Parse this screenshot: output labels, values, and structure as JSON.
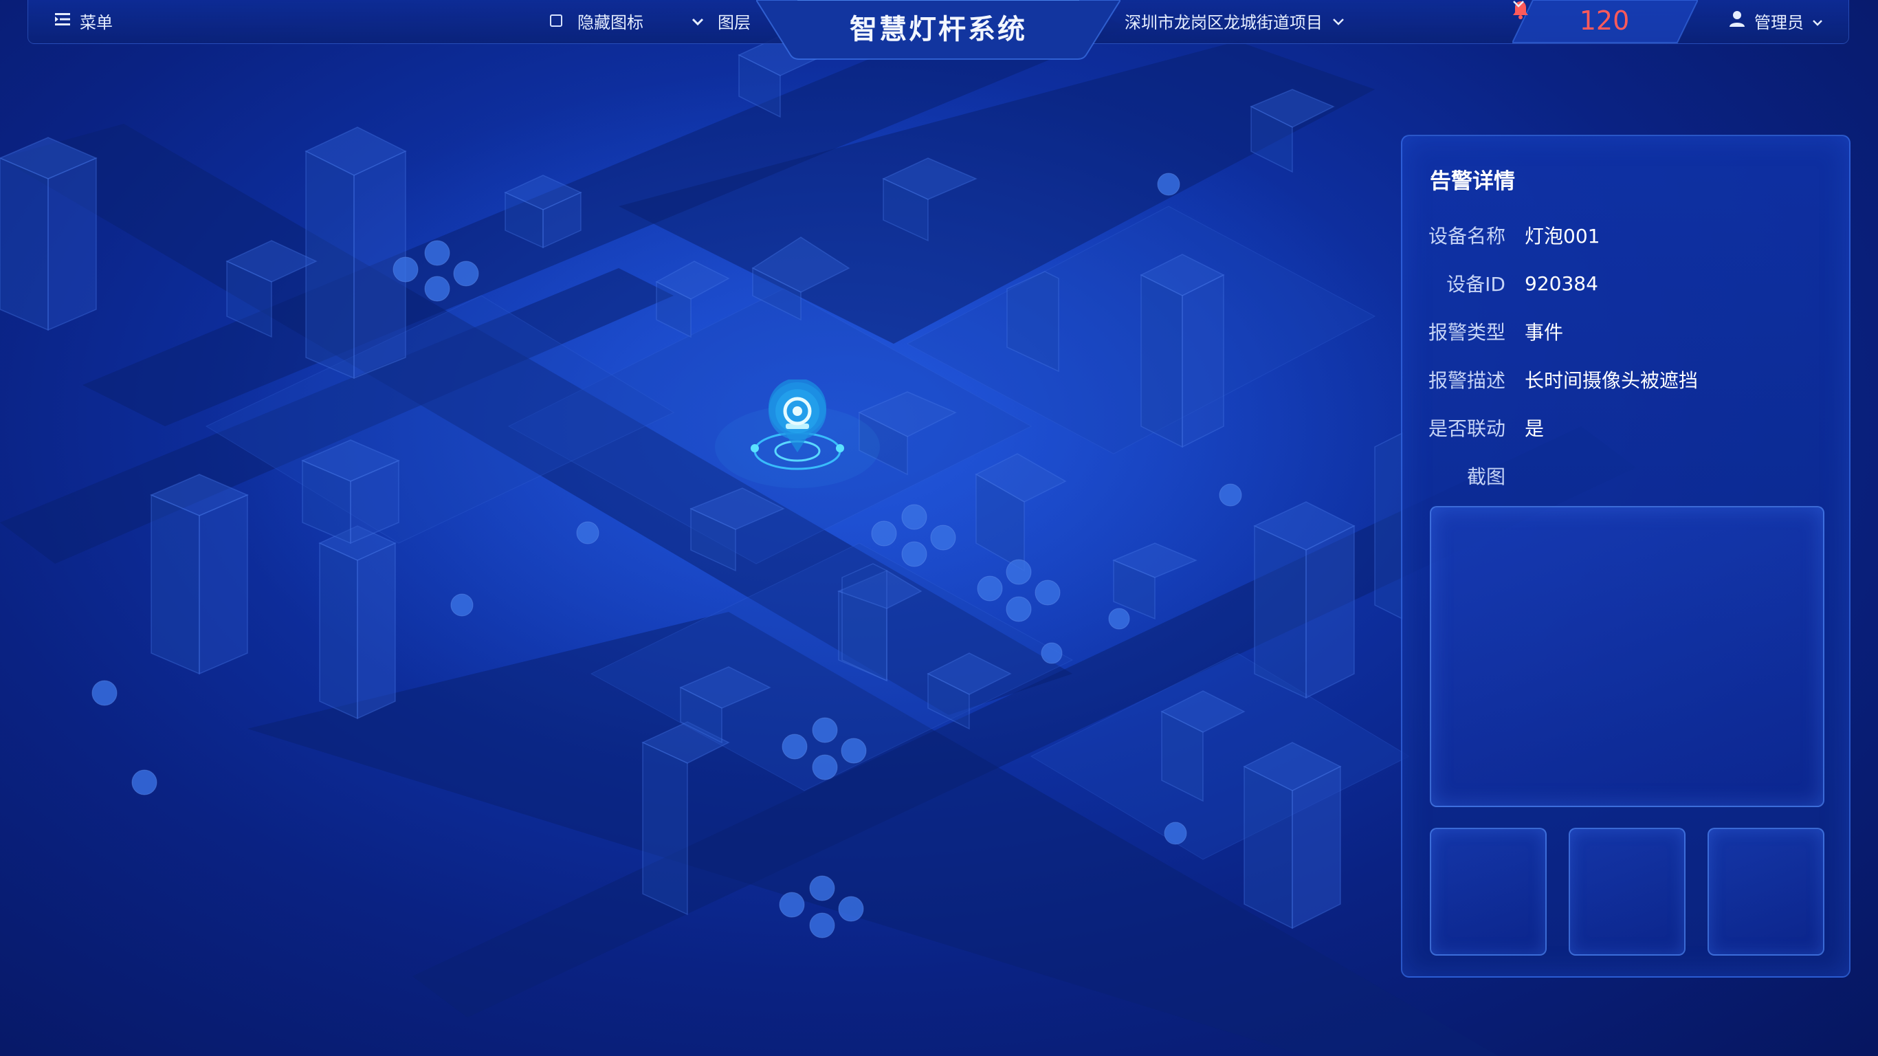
{
  "topbar": {
    "menu_label": "菜单",
    "menu_icon": "menu-list-icon",
    "hide_icons_label": "隐藏图标",
    "hide_icons_checked": false,
    "layers_label": "图层",
    "layers_icon": "chevron-down-icon",
    "app_title": "智慧灯杆系统",
    "project_label": "深圳市龙岗区龙城街道项目",
    "alarm_count": "120",
    "alarm_icon": "bell-icon",
    "user_label": "管理员",
    "user_icon": "user-icon"
  },
  "map": {
    "marker_icon": "camera-location-icon"
  },
  "alarm_panel": {
    "title": "告警详情",
    "fields": [
      {
        "label": "设备名称",
        "value": "灯泡001"
      },
      {
        "label": "设备ID",
        "value": "920384"
      },
      {
        "label": "报警类型",
        "value": "事件"
      },
      {
        "label": "报警描述",
        "value": "长时间摄像头被遮挡"
      },
      {
        "label": "是否联动",
        "value": "是"
      }
    ],
    "screenshot_label": "截图"
  },
  "colors": {
    "background": "#0f33a8",
    "accent": "#3cc8ff",
    "alarm": "#ff5a5a",
    "text": "#e6eeff"
  }
}
